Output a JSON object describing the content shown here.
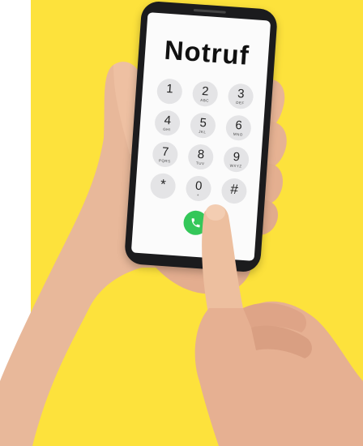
{
  "screen": {
    "title": "Notruf"
  },
  "keypad": [
    {
      "digit": "1",
      "letters": ""
    },
    {
      "digit": "2",
      "letters": "ABC"
    },
    {
      "digit": "3",
      "letters": "DEF"
    },
    {
      "digit": "4",
      "letters": "GHI"
    },
    {
      "digit": "5",
      "letters": "JKL"
    },
    {
      "digit": "6",
      "letters": "MNO"
    },
    {
      "digit": "7",
      "letters": "PQRS"
    },
    {
      "digit": "8",
      "letters": "TUV"
    },
    {
      "digit": "9",
      "letters": "WXYZ"
    },
    {
      "digit": "*",
      "letters": ""
    },
    {
      "digit": "0",
      "letters": "+"
    },
    {
      "digit": "#",
      "letters": ""
    }
  ],
  "actions": {
    "call_icon": "phone-call-icon",
    "delete_icon": "backspace-icon",
    "delete_symbol": "×"
  },
  "colors": {
    "background": "#fde23c",
    "call_button": "#34c759",
    "phone_body": "#1b1b1d"
  }
}
